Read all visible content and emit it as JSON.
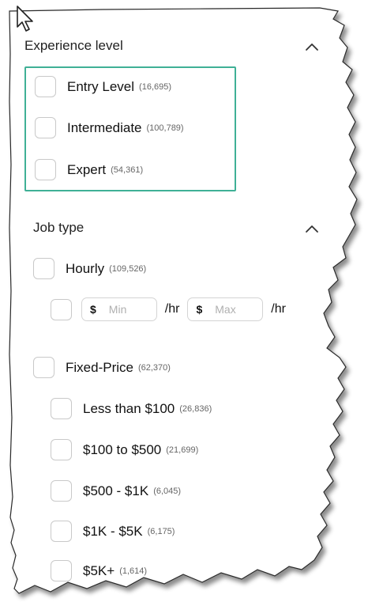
{
  "experience": {
    "title": "Experience level",
    "options": [
      {
        "label": "Entry Level",
        "count": "(16,695)"
      },
      {
        "label": "Intermediate",
        "count": "(100,789)"
      },
      {
        "label": "Expert",
        "count": "(54,361)"
      }
    ]
  },
  "job_type": {
    "title": "Job type",
    "hourly": {
      "label": "Hourly",
      "count": "(109,526)",
      "min_currency": "$",
      "min_placeholder": "Min",
      "max_currency": "$",
      "max_placeholder": "Max",
      "unit": "/hr"
    },
    "fixed": {
      "label": "Fixed-Price",
      "count": "(62,370)",
      "options": [
        {
          "label": "Less than $100",
          "count": "(26,836)"
        },
        {
          "label": "$100 to $500",
          "count": "(21,699)"
        },
        {
          "label": "$500 - $1K",
          "count": "(6,045)"
        },
        {
          "label": "$1K - $5K",
          "count": "(6,175)"
        },
        {
          "label": "$5K+",
          "count": "(1,614)"
        }
      ]
    }
  },
  "colors": {
    "highlight_border": "#3fb096",
    "checkbox_border": "#c9c9c9",
    "text": "#111111",
    "count_text": "#666666"
  },
  "icons": [
    "cursor-arrow-icon",
    "chevron-up-icon"
  ]
}
